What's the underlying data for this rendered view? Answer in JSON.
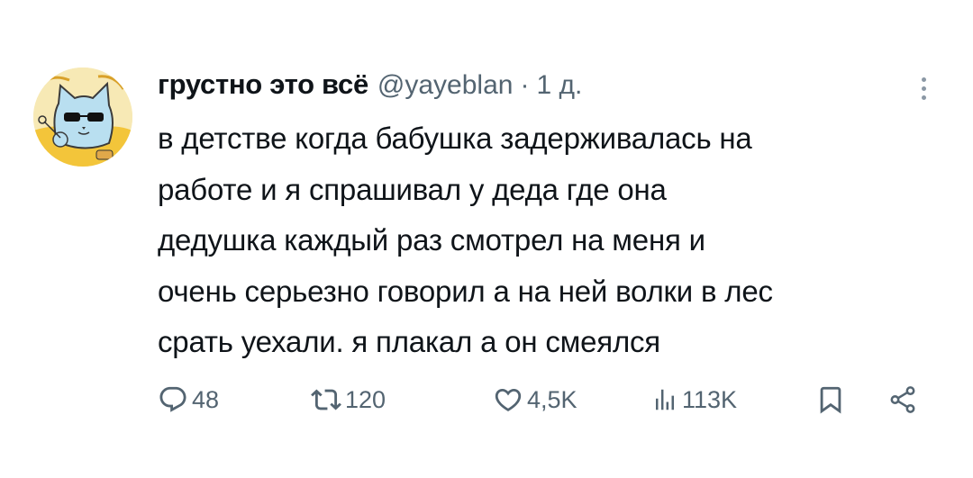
{
  "tweet": {
    "display_name": "грустно это всё",
    "handle": "@yayeblan",
    "separator": "·",
    "time": "1 д.",
    "lines": [
      "в детстве когда бабушка задерживалась на",
      "работе и я спрашивал у деда где она",
      "дедушка каждый раз смотрел на меня и",
      "очень серьезно говорил а на ней волки в лес",
      "срать уехали. я плакал а он смеялся"
    ]
  },
  "actions": {
    "replies": "48",
    "reposts": "120",
    "likes": "4,5K",
    "views": "113K"
  },
  "icons": {
    "reply": "reply-icon",
    "repost": "repost-icon",
    "like": "heart-icon",
    "views": "views-icon",
    "bookmark": "bookmark-icon",
    "share": "share-icon",
    "more": "more-vertical-icon"
  },
  "colors": {
    "text": "#0f1419",
    "secondary": "#536471",
    "avatar_bg": "#f6e7b0"
  }
}
